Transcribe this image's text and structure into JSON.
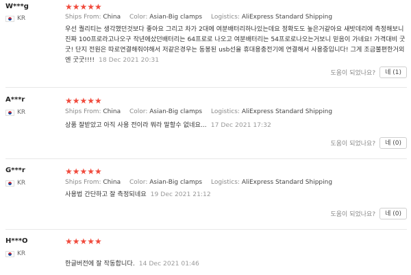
{
  "labels": {
    "ships_from": "Ships From:",
    "color": "Color:",
    "logistics": "Logistics:",
    "helpful_question": "도움이 되었나요?"
  },
  "reviews": [
    {
      "user": "W***g",
      "country": "KR",
      "rating": 5,
      "stars": "★★★★★",
      "ships_from": "China",
      "color": "Asian-Big clamps",
      "logistics": "AliExpress Standard Shipping",
      "text": "우선 퀄리티는 생각했던것보다 좋아요 그리고 차가 2대에 여분배터리하나있는데요 정확도도 높은거같아요 새밧데리에 측정해보니 진짜 100프로라고나오구 작년에샀던배터리는 64프로로 나오고 여분배터리는 54프로로나오는거보니 믿음이 가네요! 가격대비 굿굿! 단지 전원은 따로연결해줘야해서 저같은경우는 동봉된 usb선을 휴대용충전기에 연결해서 사용중입니다! 그게 조금불편한거외엔 굿굿!!!!",
      "date": "18 Dec 2021 20:31",
      "yes_label": "네 (1)"
    },
    {
      "user": "A***r",
      "country": "KR",
      "rating": 5,
      "stars": "★★★★★",
      "ships_from": "China",
      "color": "Asian-Big clamps",
      "logistics": "AliExpress Standard Shipping",
      "text": "상품 잘받았고 아직 사용 전이라 뭐라 말할수 없네요...",
      "date": "17 Dec 2021 17:32",
      "yes_label": "네 (0)"
    },
    {
      "user": "G***r",
      "country": "KR",
      "rating": 5,
      "stars": "★★★★★",
      "ships_from": "China",
      "color": "Asian-Big clamps",
      "logistics": "AliExpress Standard Shipping",
      "text": "사용법 간단하고 잘 측정되네요",
      "date": "19 Dec 2021 21:12",
      "yes_label": "네 (0)"
    },
    {
      "user": "H***O",
      "country": "KR",
      "rating": 5,
      "stars": "★★★★★",
      "text": "한글버전에 잘 작동합니다.",
      "date": "14 Dec 2021 01:46"
    }
  ],
  "colors": {
    "star": "#f04a3c",
    "flag_red": "#cd2e3a",
    "flag_blue": "#0047a0"
  }
}
